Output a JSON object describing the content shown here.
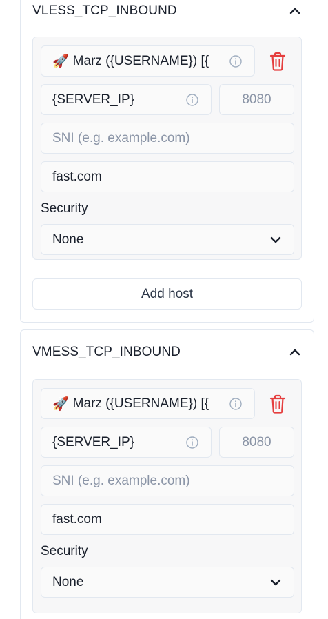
{
  "inbounds": [
    {
      "title": "VLESS_TCP_INBOUND",
      "host": {
        "remark_emoji": "🚀",
        "remark": "Marz ({USERNAME}) [{",
        "address": "{SERVER_IP}",
        "port_placeholder": "8080",
        "sni_placeholder": "SNI (e.g. example.com)",
        "host_value": "fast.com",
        "security_label": "Security",
        "security_value": "None"
      },
      "add_host_label": "Add host"
    },
    {
      "title": "VMESS_TCP_INBOUND",
      "host": {
        "remark_emoji": "🚀",
        "remark": "Marz ({USERNAME}) [{",
        "address": "{SERVER_IP}",
        "port_placeholder": "8080",
        "sni_placeholder": "SNI (e.g. example.com)",
        "host_value": "fast.com",
        "security_label": "Security",
        "security_value": "None"
      }
    }
  ],
  "colors": {
    "delete": "#e53e3e",
    "placeholder": "#8a94a6",
    "border": "#e2e8f0"
  },
  "icons": {
    "collapse": "chevron-up-icon",
    "info": "info-icon",
    "delete": "trash-icon",
    "dropdown": "chevron-down-icon"
  }
}
